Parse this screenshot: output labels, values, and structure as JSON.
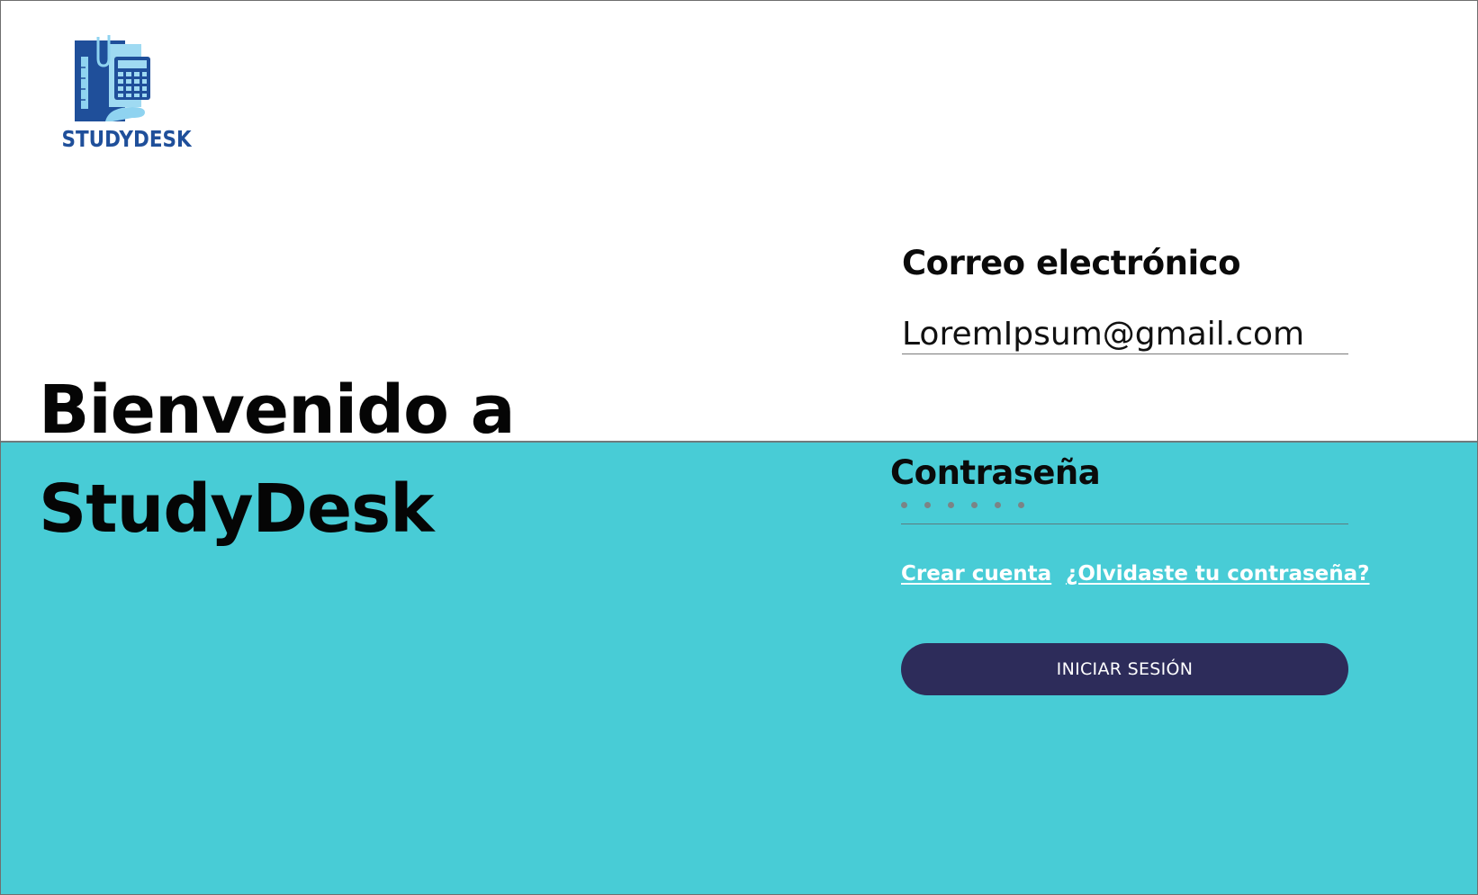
{
  "brand": {
    "logo_text": "STUDYDESK",
    "logo_icon": "notebook-calculator-icon"
  },
  "welcome": {
    "line1": "Bienvenido a",
    "line2": "StudyDesk"
  },
  "login": {
    "email_label": "Correo electrónico",
    "email_value": "LoremIpsum@gmail.com",
    "password_label": "Contraseña",
    "password_dots": 6,
    "create_account_link": "Crear cuenta",
    "forgot_password_link": "¿Olvidaste tu contraseña?",
    "submit_label": "INICIAR SESIÓN"
  },
  "colors": {
    "background_top": "#ffffff",
    "background_bottom": "#48ccd6",
    "button": "#2d2c5a",
    "brand": "#1f4f9a"
  }
}
